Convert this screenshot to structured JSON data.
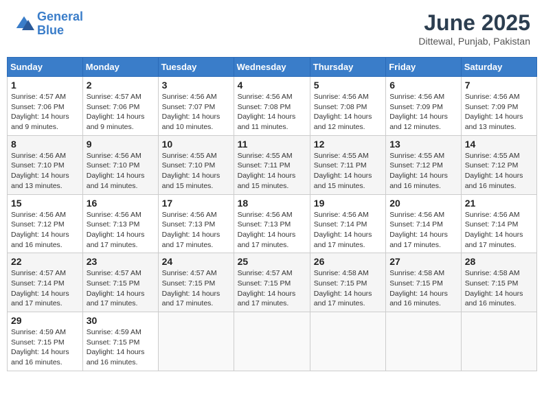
{
  "logo": {
    "line1": "General",
    "line2": "Blue"
  },
  "title": "June 2025",
  "location": "Dittewal, Punjab, Pakistan",
  "days_of_week": [
    "Sunday",
    "Monday",
    "Tuesday",
    "Wednesday",
    "Thursday",
    "Friday",
    "Saturday"
  ],
  "weeks": [
    [
      {
        "day": "1",
        "sunrise": "4:57 AM",
        "sunset": "7:06 PM",
        "daylight": "14 hours and 9 minutes."
      },
      {
        "day": "2",
        "sunrise": "4:57 AM",
        "sunset": "7:06 PM",
        "daylight": "14 hours and 9 minutes."
      },
      {
        "day": "3",
        "sunrise": "4:56 AM",
        "sunset": "7:07 PM",
        "daylight": "14 hours and 10 minutes."
      },
      {
        "day": "4",
        "sunrise": "4:56 AM",
        "sunset": "7:08 PM",
        "daylight": "14 hours and 11 minutes."
      },
      {
        "day": "5",
        "sunrise": "4:56 AM",
        "sunset": "7:08 PM",
        "daylight": "14 hours and 12 minutes."
      },
      {
        "day": "6",
        "sunrise": "4:56 AM",
        "sunset": "7:09 PM",
        "daylight": "14 hours and 12 minutes."
      },
      {
        "day": "7",
        "sunrise": "4:56 AM",
        "sunset": "7:09 PM",
        "daylight": "14 hours and 13 minutes."
      }
    ],
    [
      {
        "day": "8",
        "sunrise": "4:56 AM",
        "sunset": "7:10 PM",
        "daylight": "14 hours and 13 minutes."
      },
      {
        "day": "9",
        "sunrise": "4:56 AM",
        "sunset": "7:10 PM",
        "daylight": "14 hours and 14 minutes."
      },
      {
        "day": "10",
        "sunrise": "4:55 AM",
        "sunset": "7:10 PM",
        "daylight": "14 hours and 15 minutes."
      },
      {
        "day": "11",
        "sunrise": "4:55 AM",
        "sunset": "7:11 PM",
        "daylight": "14 hours and 15 minutes."
      },
      {
        "day": "12",
        "sunrise": "4:55 AM",
        "sunset": "7:11 PM",
        "daylight": "14 hours and 15 minutes."
      },
      {
        "day": "13",
        "sunrise": "4:55 AM",
        "sunset": "7:12 PM",
        "daylight": "14 hours and 16 minutes."
      },
      {
        "day": "14",
        "sunrise": "4:55 AM",
        "sunset": "7:12 PM",
        "daylight": "14 hours and 16 minutes."
      }
    ],
    [
      {
        "day": "15",
        "sunrise": "4:56 AM",
        "sunset": "7:12 PM",
        "daylight": "14 hours and 16 minutes."
      },
      {
        "day": "16",
        "sunrise": "4:56 AM",
        "sunset": "7:13 PM",
        "daylight": "14 hours and 17 minutes."
      },
      {
        "day": "17",
        "sunrise": "4:56 AM",
        "sunset": "7:13 PM",
        "daylight": "14 hours and 17 minutes."
      },
      {
        "day": "18",
        "sunrise": "4:56 AM",
        "sunset": "7:13 PM",
        "daylight": "14 hours and 17 minutes."
      },
      {
        "day": "19",
        "sunrise": "4:56 AM",
        "sunset": "7:14 PM",
        "daylight": "14 hours and 17 minutes."
      },
      {
        "day": "20",
        "sunrise": "4:56 AM",
        "sunset": "7:14 PM",
        "daylight": "14 hours and 17 minutes."
      },
      {
        "day": "21",
        "sunrise": "4:56 AM",
        "sunset": "7:14 PM",
        "daylight": "14 hours and 17 minutes."
      }
    ],
    [
      {
        "day": "22",
        "sunrise": "4:57 AM",
        "sunset": "7:14 PM",
        "daylight": "14 hours and 17 minutes."
      },
      {
        "day": "23",
        "sunrise": "4:57 AM",
        "sunset": "7:15 PM",
        "daylight": "14 hours and 17 minutes."
      },
      {
        "day": "24",
        "sunrise": "4:57 AM",
        "sunset": "7:15 PM",
        "daylight": "14 hours and 17 minutes."
      },
      {
        "day": "25",
        "sunrise": "4:57 AM",
        "sunset": "7:15 PM",
        "daylight": "14 hours and 17 minutes."
      },
      {
        "day": "26",
        "sunrise": "4:58 AM",
        "sunset": "7:15 PM",
        "daylight": "14 hours and 17 minutes."
      },
      {
        "day": "27",
        "sunrise": "4:58 AM",
        "sunset": "7:15 PM",
        "daylight": "14 hours and 16 minutes."
      },
      {
        "day": "28",
        "sunrise": "4:58 AM",
        "sunset": "7:15 PM",
        "daylight": "14 hours and 16 minutes."
      }
    ],
    [
      {
        "day": "29",
        "sunrise": "4:59 AM",
        "sunset": "7:15 PM",
        "daylight": "14 hours and 16 minutes."
      },
      {
        "day": "30",
        "sunrise": "4:59 AM",
        "sunset": "7:15 PM",
        "daylight": "14 hours and 16 minutes."
      },
      null,
      null,
      null,
      null,
      null
    ]
  ]
}
